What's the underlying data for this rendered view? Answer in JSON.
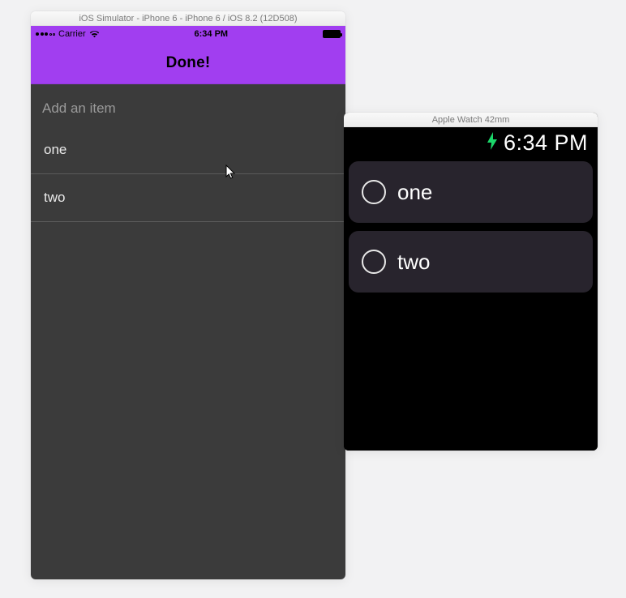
{
  "iphone": {
    "window_title": "iOS Simulator - iPhone 6 - iPhone 6 / iOS 8.2 (12D508)",
    "status": {
      "carrier": "Carrier",
      "time": "6:34 PM"
    },
    "nav_title": "Done!",
    "input_placeholder": "Add an item",
    "items": [
      {
        "label": "one"
      },
      {
        "label": "two"
      }
    ]
  },
  "watch": {
    "window_title": "Apple Watch 42mm",
    "status": {
      "charging_icon": "bolt",
      "time": "6:34 PM"
    },
    "items": [
      {
        "label": "one",
        "checked": false
      },
      {
        "label": "two",
        "checked": false
      }
    ]
  },
  "colors": {
    "accent_purple": "#a13ef0",
    "phone_bg": "#3b3b3b",
    "watch_row_bg": "#28242d",
    "charging_green": "#1bd76a"
  }
}
